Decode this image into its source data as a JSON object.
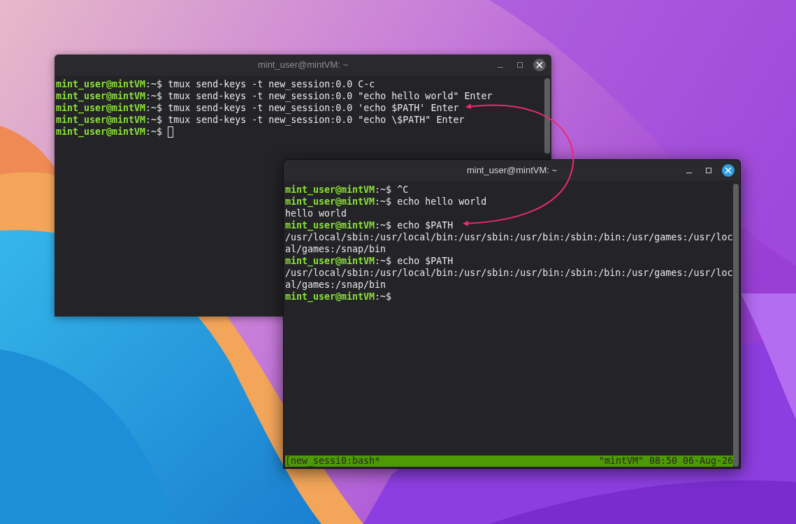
{
  "windows": [
    {
      "title": "mint_user@mintVM: ~",
      "focused": false,
      "lines": [
        {
          "kind": "prompt",
          "prompt": "mint_user@mintVM",
          "path": ":~$",
          "command": "tmux send-keys -t new_session:0.0 C-c"
        },
        {
          "kind": "prompt",
          "prompt": "mint_user@mintVM",
          "path": ":~$",
          "command": "tmux send-keys -t new_session:0.0 \"echo hello world\" Enter"
        },
        {
          "kind": "prompt",
          "prompt": "mint_user@mintVM",
          "path": ":~$",
          "command": "tmux send-keys -t new_session:0.0 'echo $PATH' Enter"
        },
        {
          "kind": "prompt",
          "prompt": "mint_user@mintVM",
          "path": ":~$",
          "command": "tmux send-keys -t new_session:0.0 \"echo \\$PATH\" Enter"
        },
        {
          "kind": "prompt",
          "prompt": "mint_user@mintVM",
          "path": ":~$",
          "cursor": true
        }
      ]
    },
    {
      "title": "mint_user@mintVM: ~",
      "focused": true,
      "lines": [
        {
          "kind": "prompt",
          "prompt": "mint_user@mintVM",
          "path": ":~$",
          "command": "^C"
        },
        {
          "kind": "prompt",
          "prompt": "mint_user@mintVM",
          "path": ":~$",
          "command": "echo hello world"
        },
        {
          "kind": "output",
          "text": "hello world"
        },
        {
          "kind": "prompt",
          "prompt": "mint_user@mintVM",
          "path": ":~$",
          "command": "echo $PATH"
        },
        {
          "kind": "output",
          "text": "/usr/local/sbin:/usr/local/bin:/usr/sbin:/usr/bin:/sbin:/bin:/usr/games:/usr/loc"
        },
        {
          "kind": "output",
          "text": "al/games:/snap/bin"
        },
        {
          "kind": "prompt",
          "prompt": "mint_user@mintVM",
          "path": ":~$",
          "command": "echo $PATH"
        },
        {
          "kind": "output",
          "text": "/usr/local/sbin:/usr/local/bin:/usr/sbin:/usr/bin:/sbin:/bin:/usr/games:/usr/loc"
        },
        {
          "kind": "output",
          "text": "al/games:/snap/bin"
        },
        {
          "kind": "prompt",
          "prompt": "mint_user@mintVM",
          "path": ":~$"
        }
      ],
      "status_bar": {
        "left": "[new_sessi0:bash*",
        "right": "\"mintVM\" 08:50 06-Aug-26"
      }
    }
  ]
}
